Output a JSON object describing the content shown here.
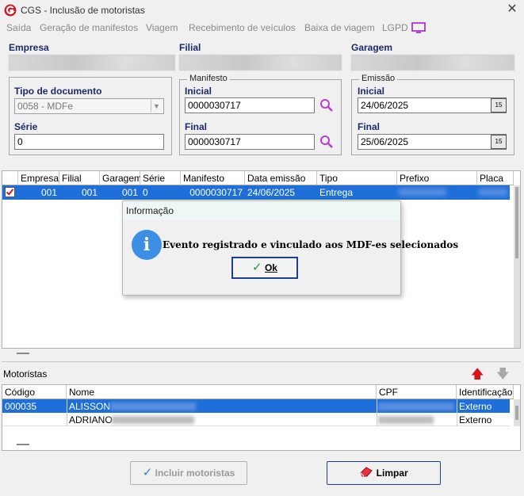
{
  "window": {
    "title": "CGS - Inclusão de motoristas",
    "close_glyph": "✕"
  },
  "menu": [
    "Saída",
    "Geração de manifestos",
    "Viagem",
    "Recebimento de veículos",
    "Baixa de viagem",
    "LGPD"
  ],
  "header": {
    "empresa_label": "Empresa",
    "filial_label": "Filial",
    "garagem_label": "Garagem"
  },
  "tipo_documento": {
    "label": "Tipo de documento",
    "value": "0058 - MDFe"
  },
  "serie": {
    "label": "Série",
    "value": "0"
  },
  "manifesto": {
    "legend": "Manifesto",
    "inicial_label": "Inicial",
    "inicial_value": "0000030717",
    "final_label": "Final",
    "final_value": "0000030717"
  },
  "emissao": {
    "legend": "Emissão",
    "inicial_label": "Inicial",
    "inicial_value": "24/06/2025",
    "final_label": "Final",
    "final_value": "25/06/2025",
    "calendar_glyph": "15"
  },
  "manifest_grid": {
    "columns": [
      "Empresa",
      "Filial",
      "Garagem",
      "Série",
      "Manifesto",
      "Data emissão",
      "Tipo",
      "Prefixo",
      "Placa"
    ],
    "rows": [
      {
        "checked": true,
        "empresa": "001",
        "filial": "001",
        "garagem": "001",
        "serie": "0",
        "manifesto": "0000030717",
        "data_emissao": "24/06/2025",
        "tipo": "Entrega"
      }
    ]
  },
  "dialog": {
    "title": "Informação",
    "icon_glyph": "i",
    "message": "Evento registrado e vinculado aos MDF-es selecionados",
    "ok_label": "Ok",
    "ok_check": "✓"
  },
  "motoristas": {
    "label": "Motoristas",
    "up_arrow": "🡅",
    "down_arrow": "🡇",
    "columns": [
      "Código",
      "Nome",
      "CPF",
      "Identificação"
    ],
    "rows": [
      {
        "codigo": "000035",
        "nome": "ALISSON",
        "identificacao": "Externo"
      },
      {
        "codigo": "",
        "nome": "ADRIANO",
        "identificacao": "Externo"
      }
    ]
  },
  "buttons": {
    "incluir_label": "Incluir motoristas",
    "incluir_check": "✓",
    "limpar_label": "Limpar"
  },
  "colors": {
    "selection": "#1e6fd9",
    "label_blue": "#1a2a6c",
    "brand_red": "#c8202a",
    "info_blue": "#3c8fe3"
  }
}
